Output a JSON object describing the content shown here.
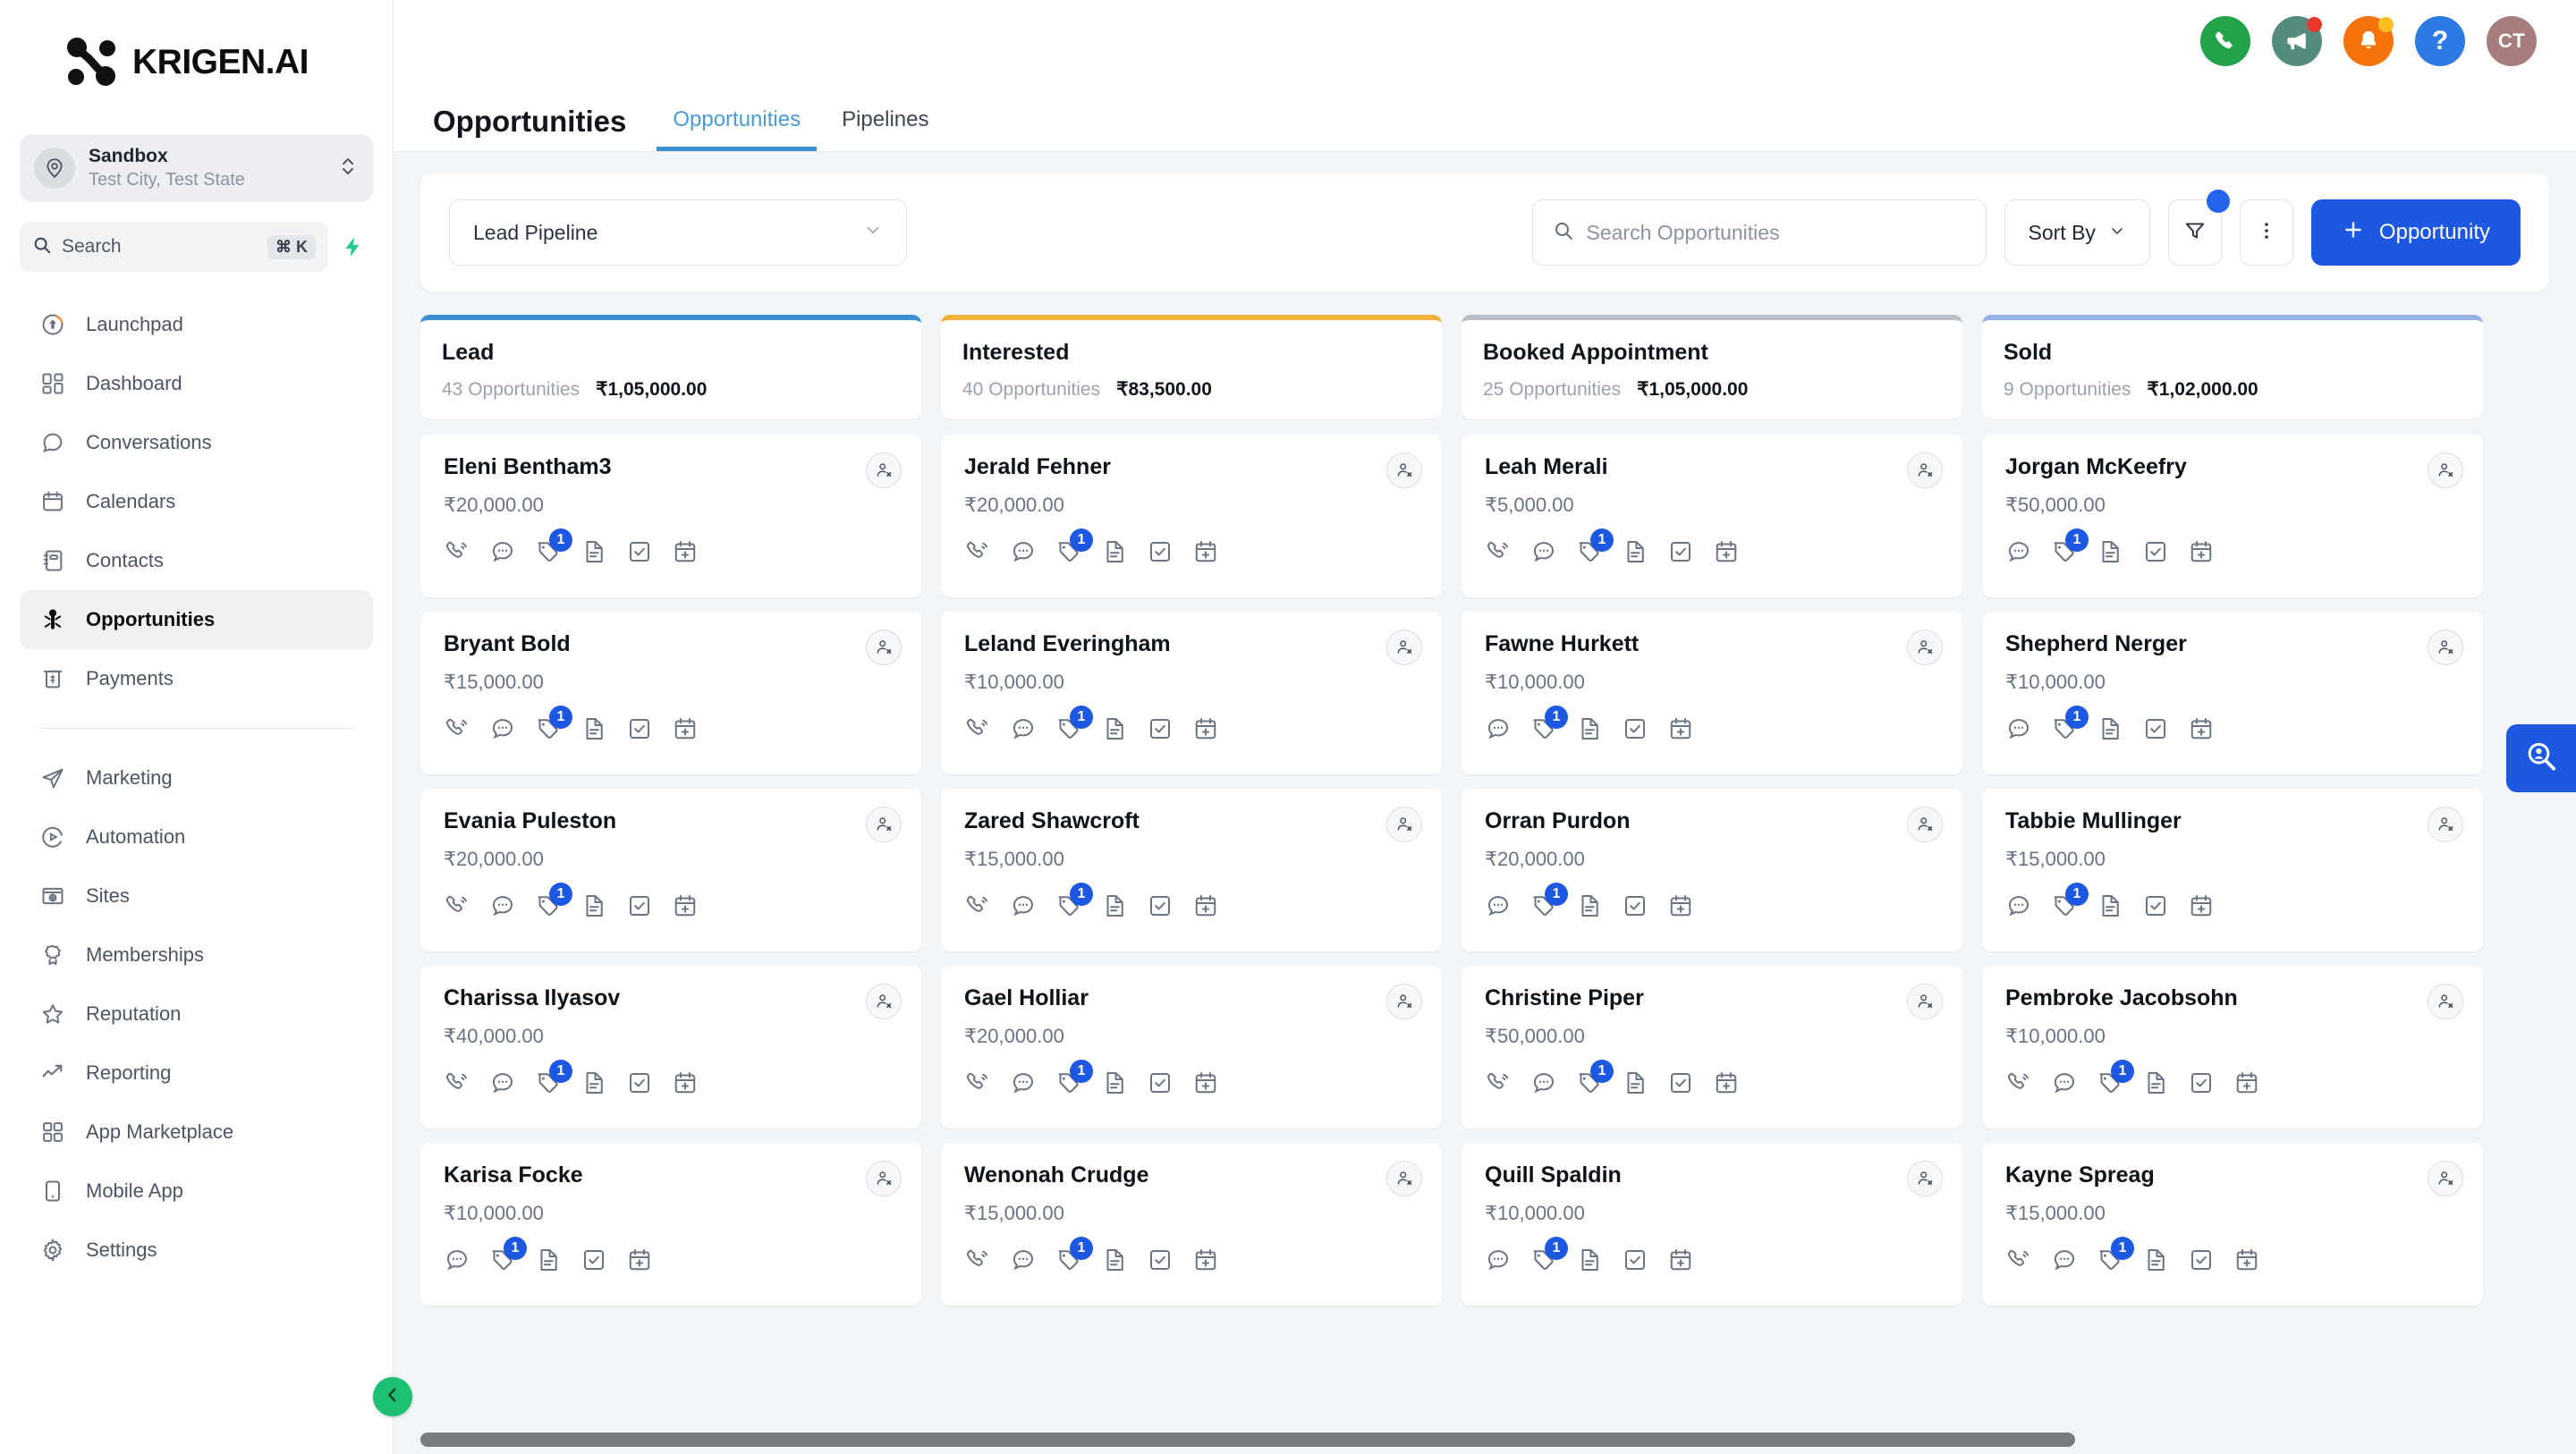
{
  "brand": {
    "name": "KRIGEN.AI",
    "logo_icon": "krigen-logo-icon"
  },
  "location": {
    "name": "Sandbox",
    "sub": "Test City, Test State",
    "avatar_icon": "location-pin-icon",
    "chevron_icon": "chevron-up-down-icon"
  },
  "sidebar_search": {
    "label": "Search",
    "shortcut": "⌘ K",
    "search_icon": "search-icon",
    "bolt_icon": "lightning-bolt-icon"
  },
  "sidebar": {
    "items_top": [
      {
        "label": "Launchpad",
        "icon": "rocket-launchpad-icon",
        "active": false
      },
      {
        "label": "Dashboard",
        "icon": "dashboard-grid-icon",
        "active": false
      },
      {
        "label": "Conversations",
        "icon": "chat-bubble-icon",
        "active": false
      },
      {
        "label": "Calendars",
        "icon": "calendar-icon",
        "active": false
      },
      {
        "label": "Contacts",
        "icon": "contacts-book-icon",
        "active": false
      },
      {
        "label": "Opportunities",
        "icon": "opportunities-person-icon",
        "active": true
      },
      {
        "label": "Payments",
        "icon": "payments-receipt-icon",
        "active": false
      }
    ],
    "items_bottom": [
      {
        "label": "Marketing",
        "icon": "paper-plane-icon",
        "active": false
      },
      {
        "label": "Automation",
        "icon": "play-circle-icon",
        "active": false
      },
      {
        "label": "Sites",
        "icon": "browser-globe-icon",
        "active": false
      },
      {
        "label": "Memberships",
        "icon": "badge-ribbon-icon",
        "active": false
      },
      {
        "label": "Reputation",
        "icon": "star-icon",
        "active": false
      },
      {
        "label": "Reporting",
        "icon": "trend-up-icon",
        "active": false
      },
      {
        "label": "App Marketplace",
        "icon": "grid-apps-icon",
        "active": false
      },
      {
        "label": "Mobile App",
        "icon": "mobile-device-icon",
        "active": false
      },
      {
        "label": "Settings",
        "icon": "gear-icon",
        "active": false
      }
    ],
    "collapse_icon": "chevron-left-icon"
  },
  "topbar": {
    "icons": [
      {
        "name": "phone-call-icon",
        "bg": "#21a34a",
        "dot": null
      },
      {
        "name": "megaphone-announcement-icon",
        "bg": "#548c7e",
        "dot": "#e8392c"
      },
      {
        "name": "bell-notification-icon",
        "bg": "#f5730b",
        "dot": "#fbbf24"
      },
      {
        "name": "help-question-icon",
        "bg": "#2d7ae5",
        "dot": null
      }
    ],
    "avatar": {
      "initials": "CT",
      "bg": "#a87d7d"
    }
  },
  "page": {
    "title": "Opportunities",
    "tabs": [
      {
        "label": "Opportunities",
        "active": true
      },
      {
        "label": "Pipelines",
        "active": false
      }
    ]
  },
  "toolbar": {
    "pipeline": {
      "value": "Lead Pipeline",
      "chevron_icon": "chevron-down-icon"
    },
    "search": {
      "placeholder": "Search Opportunities",
      "icon": "search-icon"
    },
    "sort": {
      "label": "Sort By",
      "chevron_icon": "chevron-down-icon"
    },
    "filter": {
      "icon": "filter-funnel-icon",
      "badge": true
    },
    "more": {
      "icon": "more-vertical-dots-icon"
    },
    "add": {
      "label": "Opportunity",
      "plus_icon": "plus-icon"
    }
  },
  "board": {
    "columns": [
      {
        "name": "Lead",
        "count": "43 Opportunities",
        "total": "₹1,05,000.00",
        "accent": "#3b8ed6",
        "cards": [
          {
            "name": "Eleni Bentham3",
            "amount": "₹20,000.00",
            "has_call": true,
            "tag_badge": "1"
          },
          {
            "name": "Bryant Bold",
            "amount": "₹15,000.00",
            "has_call": true,
            "tag_badge": "1"
          },
          {
            "name": "Evania Puleston",
            "amount": "₹20,000.00",
            "has_call": true,
            "tag_badge": "1"
          },
          {
            "name": "Charissa Ilyasov",
            "amount": "₹40,000.00",
            "has_call": true,
            "tag_badge": "1"
          },
          {
            "name": "Karisa Focke",
            "amount": "₹10,000.00",
            "has_call": false,
            "tag_badge": "1"
          }
        ]
      },
      {
        "name": "Interested",
        "count": "40 Opportunities",
        "total": "₹83,500.00",
        "accent": "#f0b23c",
        "cards": [
          {
            "name": "Jerald Fehner",
            "amount": "₹20,000.00",
            "has_call": true,
            "tag_badge": "1"
          },
          {
            "name": "Leland Everingham",
            "amount": "₹10,000.00",
            "has_call": true,
            "tag_badge": "1"
          },
          {
            "name": "Zared Shawcroft",
            "amount": "₹15,000.00",
            "has_call": true,
            "tag_badge": "1"
          },
          {
            "name": "Gael Holliar",
            "amount": "₹20,000.00",
            "has_call": true,
            "tag_badge": "1"
          },
          {
            "name": "Wenonah Crudge",
            "amount": "₹15,000.00",
            "has_call": true,
            "tag_badge": "1"
          }
        ]
      },
      {
        "name": "Booked Appointment",
        "count": "25 Opportunities",
        "total": "₹1,05,000.00",
        "accent": "#b9bfc9",
        "cards": [
          {
            "name": "Leah Merali",
            "amount": "₹5,000.00",
            "has_call": true,
            "tag_badge": "1"
          },
          {
            "name": "Fawne Hurkett",
            "amount": "₹10,000.00",
            "has_call": false,
            "tag_badge": "1"
          },
          {
            "name": "Orran Purdon",
            "amount": "₹20,000.00",
            "has_call": false,
            "tag_badge": "1"
          },
          {
            "name": "Christine Piper",
            "amount": "₹50,000.00",
            "has_call": true,
            "tag_badge": "1"
          },
          {
            "name": "Quill Spaldin",
            "amount": "₹10,000.00",
            "has_call": false,
            "tag_badge": "1"
          }
        ]
      },
      {
        "name": "Sold",
        "count": "9 Opportunities",
        "total": "₹1,02,000.00",
        "accent": "#95b0e8",
        "cards": [
          {
            "name": "Jorgan McKeefry",
            "amount": "₹50,000.00",
            "has_call": false,
            "tag_badge": "1"
          },
          {
            "name": "Shepherd Nerger",
            "amount": "₹10,000.00",
            "has_call": false,
            "tag_badge": "1"
          },
          {
            "name": "Tabbie Mullinger",
            "amount": "₹15,000.00",
            "has_call": false,
            "tag_badge": "1"
          },
          {
            "name": "Pembroke Jacobsohn",
            "amount": "₹10,000.00",
            "has_call": true,
            "tag_badge": "1"
          },
          {
            "name": "Kayne Spreag",
            "amount": "₹15,000.00",
            "has_call": true,
            "tag_badge": "1"
          }
        ]
      }
    ],
    "card_action_icons": [
      "phone-call-icon",
      "sms-chat-icon",
      "tag-icon",
      "document-note-icon",
      "task-check-icon",
      "calendar-add-icon"
    ],
    "card_avatar_icon": "user-remove-icon"
  },
  "fab": {
    "icon": "contact-lookup-search-icon",
    "bg": "#1d58e3"
  }
}
